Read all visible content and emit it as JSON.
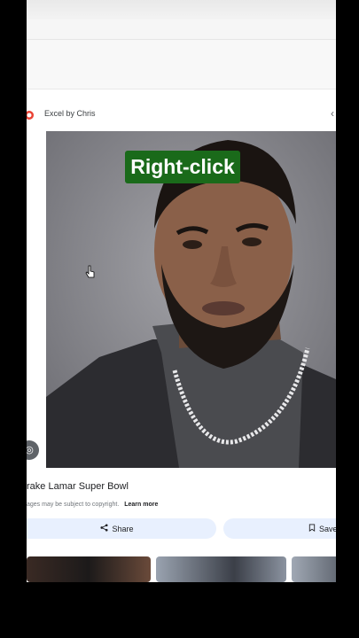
{
  "source": {
    "name": "Excel by Chris",
    "logo_icon": "google-logo-icon",
    "close_icon": "chevron-left-icon"
  },
  "overlay": {
    "label": "Right-click",
    "label_color": "#1a6a1a"
  },
  "result": {
    "title": "rake Lamar Super Bowl",
    "copyright": "ages may be subject to copyright.",
    "learn_more": "Learn more"
  },
  "actions": {
    "share": "Share",
    "save": "Save"
  },
  "icons": {
    "lens": "google-lens-icon",
    "cursor": "hand-pointer-icon",
    "share": "share-icon",
    "save": "bookmark-icon"
  }
}
